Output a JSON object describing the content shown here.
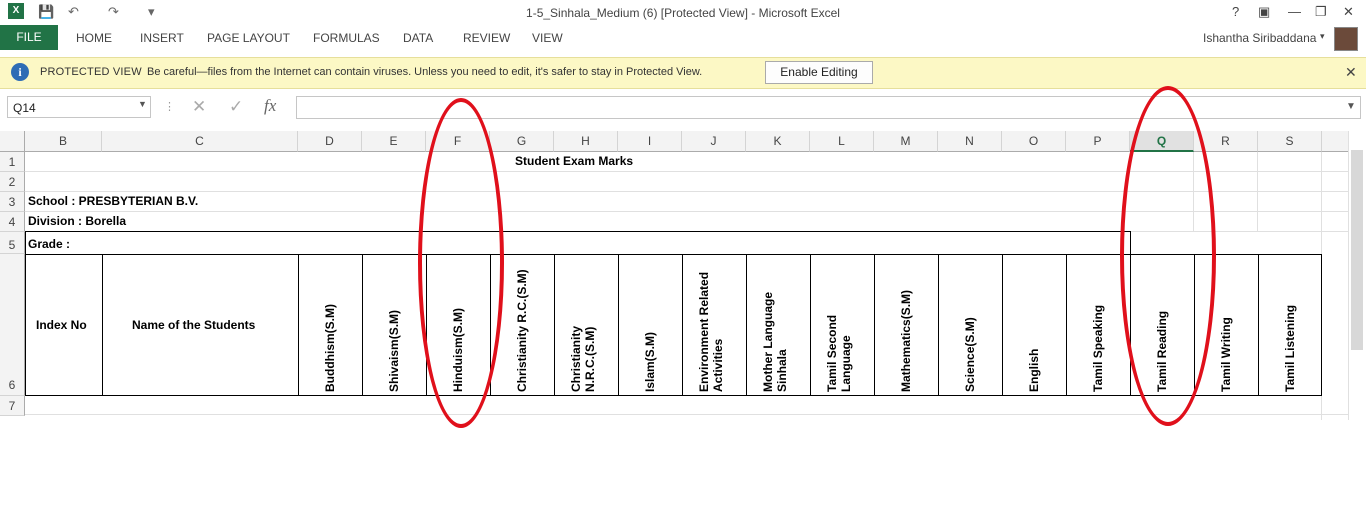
{
  "window": {
    "title": "1-5_Sinhala_Medium (6)  [Protected View] - Microsoft Excel",
    "help": "?",
    "controls": [
      "restore-icon",
      "minimize-icon",
      "maximize-icon",
      "close-icon"
    ]
  },
  "quick_access": {
    "app_icon": "excel-icon",
    "save_icon": "save-icon",
    "undo_icon": "undo-icon",
    "redo_icon": "redo-icon",
    "customize": "▾"
  },
  "ribbon": {
    "file": "FILE",
    "tabs": [
      "HOME",
      "INSERT",
      "PAGE LAYOUT",
      "FORMULAS",
      "DATA",
      "REVIEW",
      "VIEW"
    ],
    "user": "Ishantha Siribaddana"
  },
  "protected_view": {
    "title": "PROTECTED VIEW",
    "message": "Be careful—files from the Internet can contain viruses. Unless you need to edit, it's safer to stay in Protected View.",
    "button": "Enable Editing",
    "close": "✕"
  },
  "formula_bar": {
    "name_box": "Q14",
    "fx": "fx",
    "value": ""
  },
  "columns": [
    "B",
    "C",
    "D",
    "E",
    "F",
    "G",
    "H",
    "I",
    "J",
    "K",
    "L",
    "M",
    "N",
    "O",
    "P",
    "Q",
    "R",
    "S"
  ],
  "selected_column": "Q",
  "rows": [
    "1",
    "2",
    "3",
    "4",
    "5",
    "6",
    "7"
  ],
  "sheet": {
    "title": "Student Exam Marks",
    "school": "School : PRESBYTERIAN B.V.",
    "division": "Division : Borella",
    "grade": "Grade :",
    "index_no": "Index No",
    "name_col": "Name of the Students",
    "subjects": [
      "Buddhism(S.M)",
      "Shivaism(S.M)",
      "Hinduism(S.M)",
      "Christianity R.C.(S.M)",
      "Christianity N.R.C.(S.M)",
      "Islam(S.M)",
      "Environment Related Activities",
      "Mother Language Sinhala",
      "Tamil Second Language",
      "Mathematics(S.M)",
      "Science(S.M)",
      "English",
      "Tamil Speaking",
      "Tamil Reading",
      "Tamil Writing",
      "Tamil Listening"
    ]
  },
  "annotations": {
    "highlight_color": "#e0101b",
    "circled_columns": [
      "F",
      "Q"
    ]
  }
}
